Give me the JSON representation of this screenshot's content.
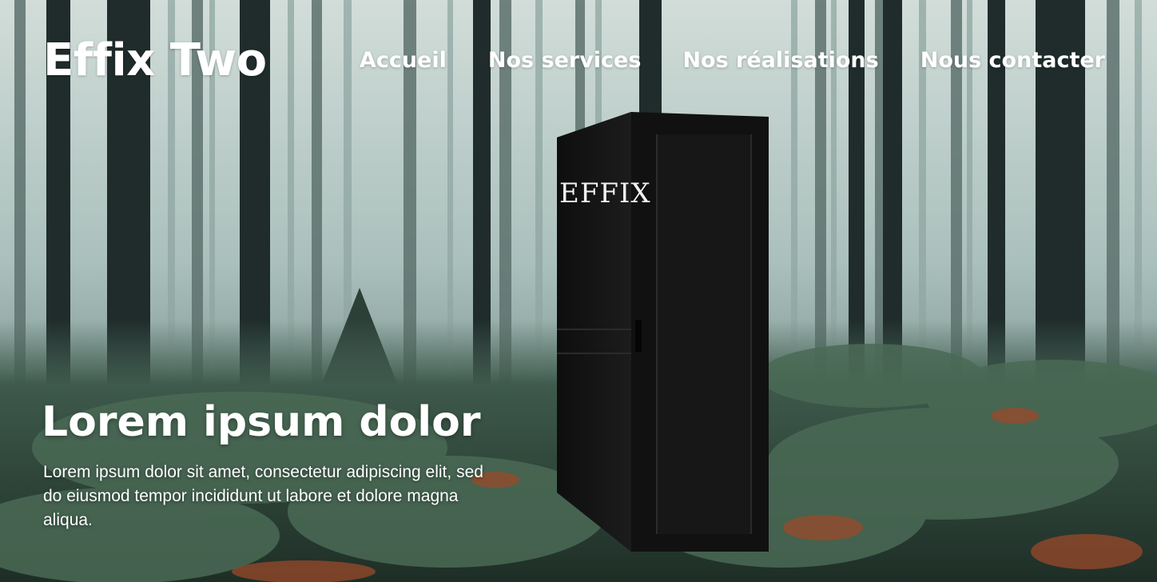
{
  "header": {
    "brand": "Effix Two",
    "nav": [
      {
        "label": "Accueil"
      },
      {
        "label": "Nos services"
      },
      {
        "label": "Nos réalisations"
      },
      {
        "label": "Nous contacter"
      }
    ]
  },
  "hero": {
    "product_logo": "EFFIX",
    "title": "Lorem ipsum dolor",
    "text": "Lorem ipsum dolor sit amet, consectetur adipiscing elit, sed do eiusmod tempor incididunt ut labore et dolore magna aliqua."
  },
  "colors": {
    "fog": "#c4d4d0",
    "trunk": "#1f2c2b",
    "fern": "#3e5a4a",
    "rust": "#9a4a2a",
    "rack": "#141414",
    "text": "#ffffff"
  }
}
